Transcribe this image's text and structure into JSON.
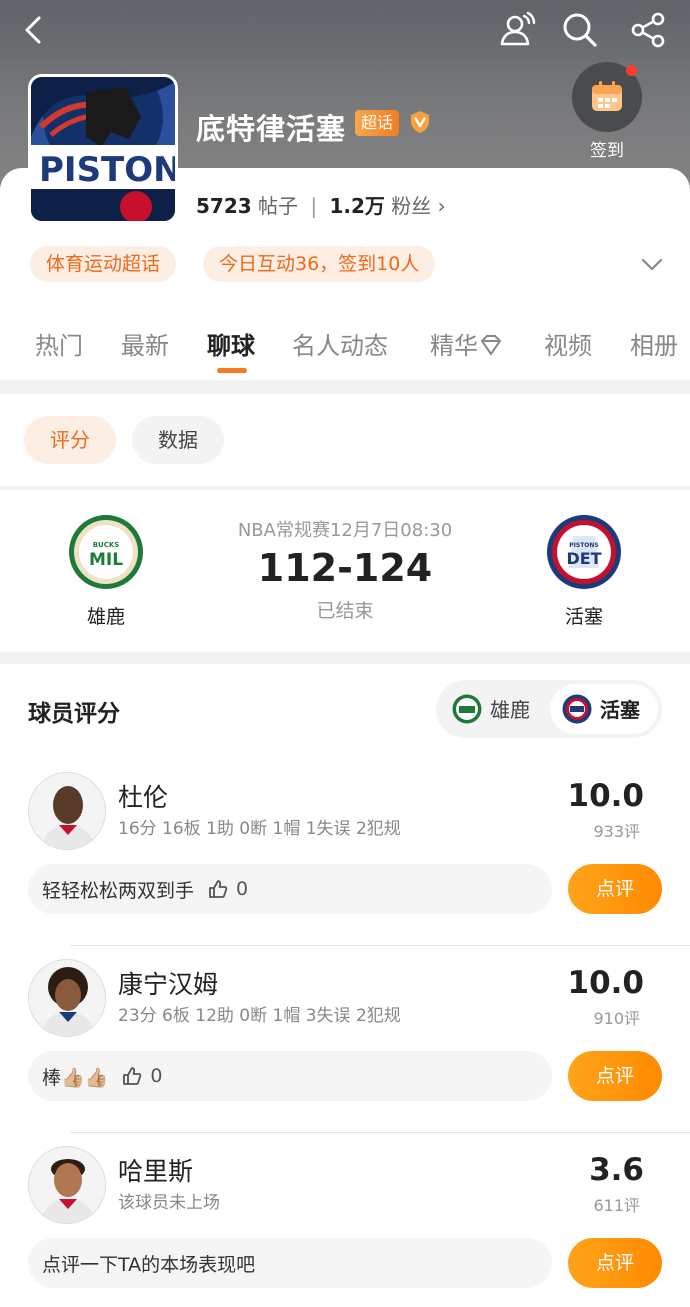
{
  "header": {
    "team_title": "底特律活塞",
    "super_tag": "超话",
    "checkin_label": "签到",
    "posts_count": "5723",
    "posts_label": "帖子",
    "fans_count": "1.2万",
    "fans_label": "粉丝",
    "category_pill": "体育运动超话",
    "activity_pill": "今日互动36，签到10人",
    "logo_text": "PISTONS"
  },
  "tabs": [
    "热门",
    "最新",
    "聊球",
    "名人动态",
    "精华",
    "视频",
    "相册"
  ],
  "segments": {
    "rating": "评分",
    "data": "数据"
  },
  "match": {
    "home_team": "雄鹿",
    "home_badge_top": "BUCKS",
    "home_badge": "MIL",
    "away_team": "活塞",
    "away_badge_top": "PISTONS",
    "away_badge": "DET",
    "info": "NBA常规赛12月7日08:30",
    "score": "112-124",
    "status": "已结束"
  },
  "ratings": {
    "title": "球员评分",
    "switch_left": "雄鹿",
    "switch_right": "活塞",
    "players": [
      {
        "name": "杜伦",
        "stats": "16分 16板 1助 0断 1帽 1失误 2犯规",
        "score": "10.0",
        "count": "933评",
        "comment": "轻轻松松两双到手",
        "likes": "0",
        "button": "点评"
      },
      {
        "name": "康宁汉姆",
        "stats": "23分 6板 12助 0断 1帽 3失误 2犯规",
        "score": "10.0",
        "count": "910评",
        "comment": "棒👍🏼👍🏼",
        "likes": "0",
        "button": "点评"
      },
      {
        "name": "哈里斯",
        "stats": "该球员未上场",
        "score": "3.6",
        "count": "611评",
        "comment": "点评一下TA的本场表现吧",
        "likes": "",
        "button": "点评"
      }
    ]
  },
  "colors": {
    "accent": "#f47b20",
    "pill_bg": "#fdeee3",
    "bucks_green": "#1f7a3a",
    "pistons_blue": "#1d3a7a",
    "pistons_red": "#c8102e"
  }
}
